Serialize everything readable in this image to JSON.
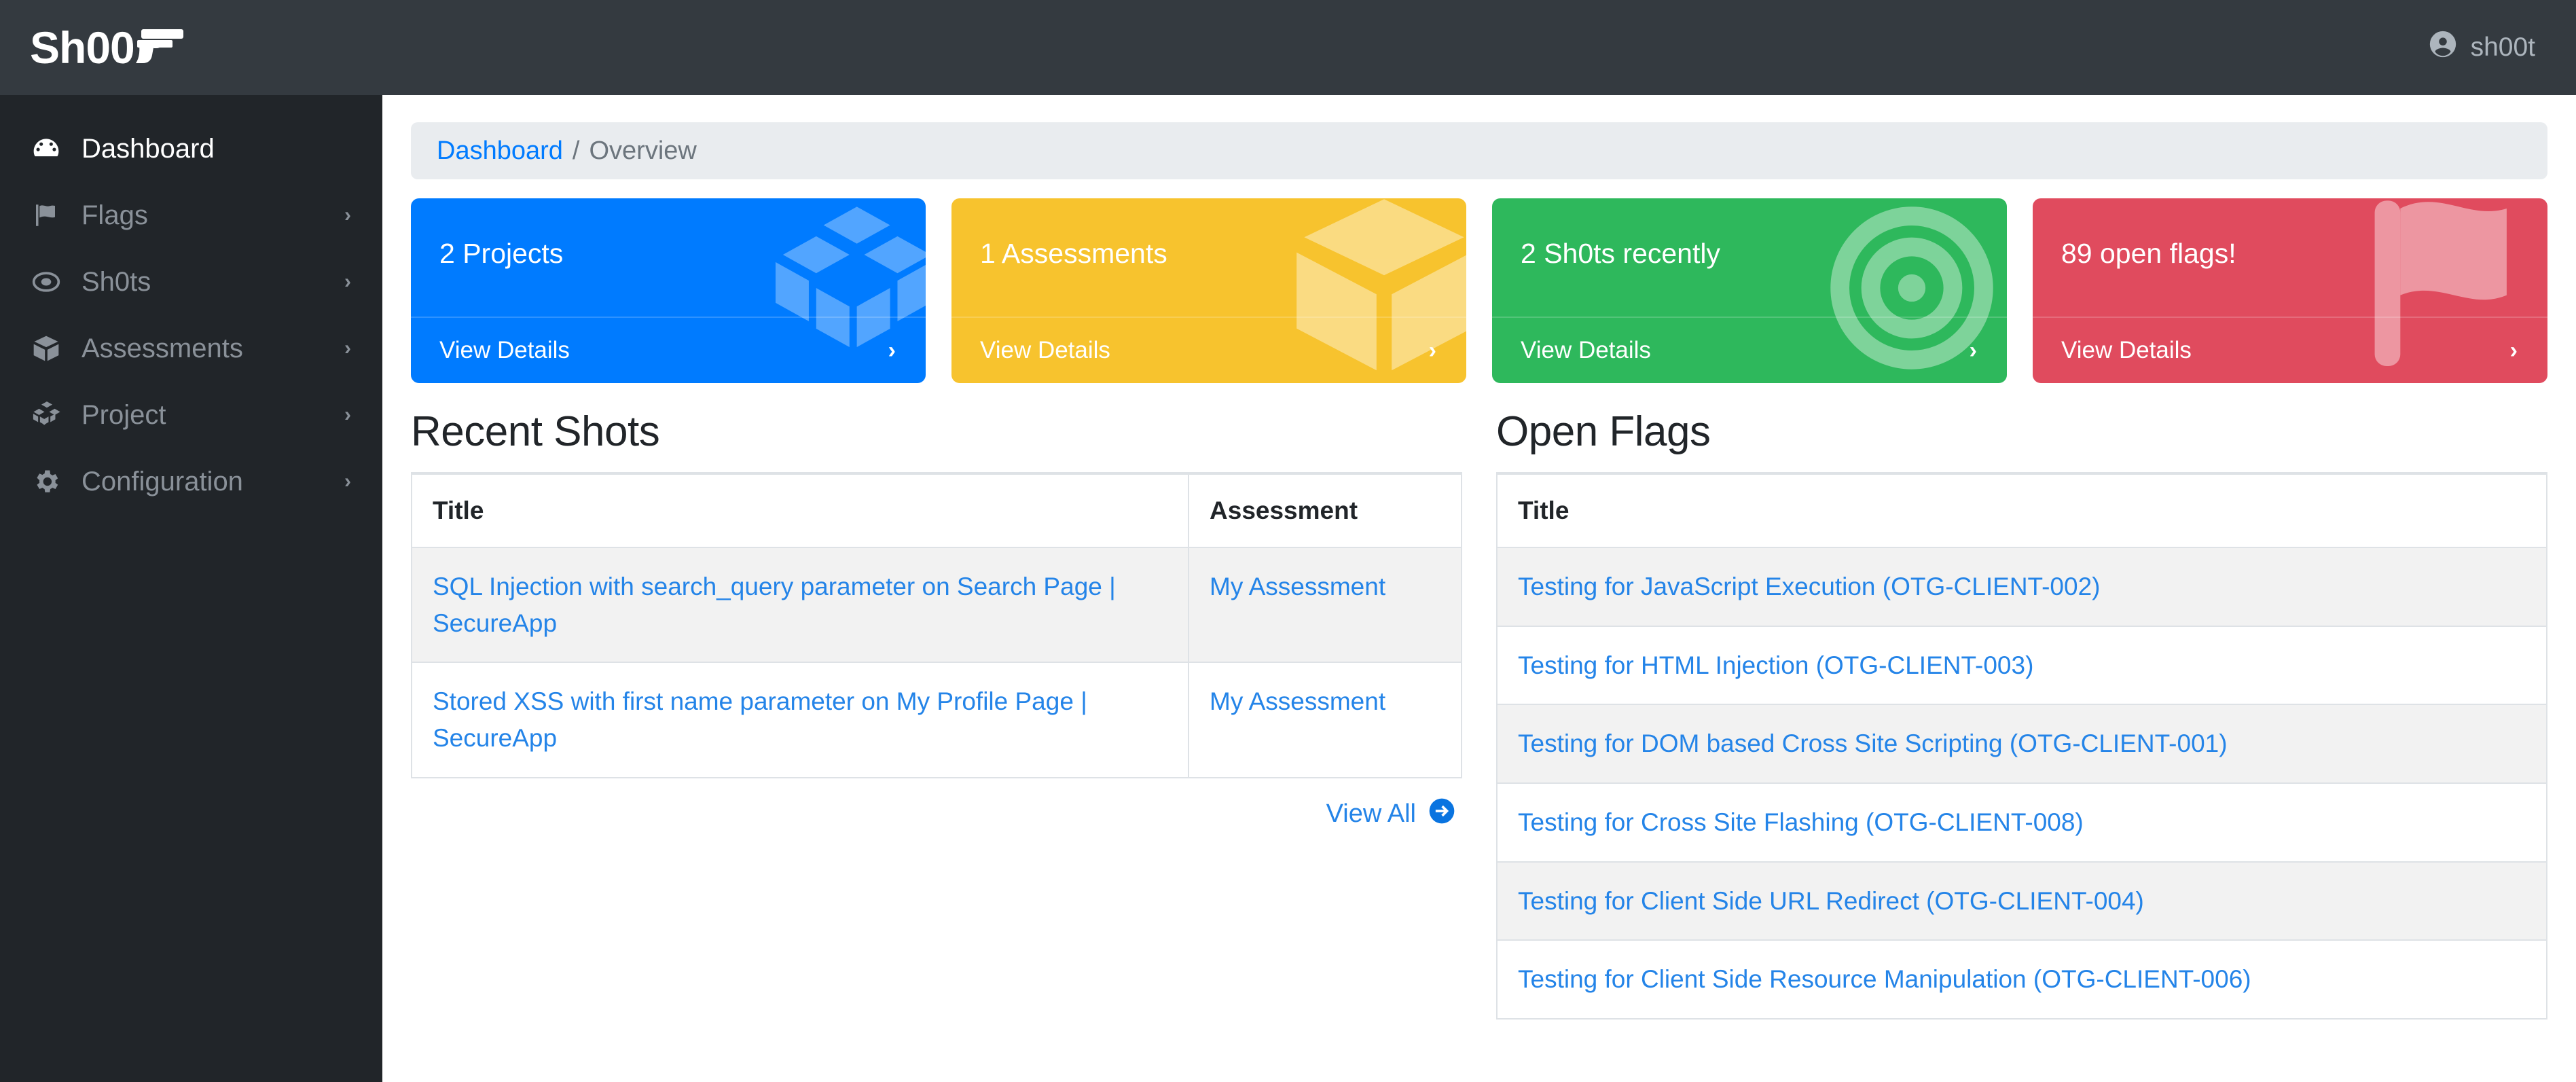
{
  "header": {
    "brand_text": "Sh00",
    "brand_icon": "pistol-icon",
    "user_name": "sh00t",
    "user_icon": "user-circle-icon",
    "background_color": "#343a40"
  },
  "sidebar": {
    "background_color": "#212529",
    "items": [
      {
        "label": "Dashboard",
        "icon": "tachometer-icon",
        "active": true,
        "chevron": ""
      },
      {
        "label": "Flags",
        "icon": "flag-icon",
        "active": false,
        "chevron": "›"
      },
      {
        "label": "Sh0ts",
        "icon": "bullseye-icon",
        "active": false,
        "chevron": "›"
      },
      {
        "label": "Assessments",
        "icon": "box-icon",
        "active": false,
        "chevron": "›"
      },
      {
        "label": "Project",
        "icon": "cubes-icon",
        "active": false,
        "chevron": "›"
      },
      {
        "label": "Configuration",
        "icon": "gear-icon",
        "active": false,
        "chevron": "›"
      }
    ]
  },
  "breadcrumb": {
    "link_label": "Dashboard",
    "separator": "/",
    "current_label": "Overview"
  },
  "cards": [
    {
      "value_label": "2 Projects",
      "footer_label": "View Details",
      "chevron": "›",
      "color": "#007bff",
      "icon": "cubes-icon"
    },
    {
      "value_label": "1 Assessments",
      "footer_label": "View Details",
      "chevron": "›",
      "color": "#f7c32e",
      "icon": "box-icon"
    },
    {
      "value_label": "2 Sh0ts recently",
      "footer_label": "View Details",
      "chevron": "›",
      "color": "#2eb85c",
      "icon": "bullseye-icon"
    },
    {
      "value_label": "89 open flags!",
      "footer_label": "View Details",
      "chevron": "›",
      "color": "#e04b5e",
      "icon": "flag-icon"
    }
  ],
  "recent_shots": {
    "title": "Recent Shots",
    "columns": [
      "Title",
      "Assessment"
    ],
    "rows": [
      {
        "title": "SQL Injection with search_query parameter on Search Page | SecureApp",
        "assessment": "My Assessment"
      },
      {
        "title": "Stored XSS with first name parameter on My Profile Page | SecureApp",
        "assessment": "My Assessment"
      }
    ],
    "view_all_label": "View All",
    "view_all_icon": "arrow-circle-right-icon"
  },
  "open_flags": {
    "title": "Open Flags",
    "columns": [
      "Title"
    ],
    "rows": [
      {
        "title": "Testing for JavaScript Execution (OTG-CLIENT-002)"
      },
      {
        "title": "Testing for HTML Injection (OTG-CLIENT-003)"
      },
      {
        "title": "Testing for DOM based Cross Site Scripting (OTG-CLIENT-001)"
      },
      {
        "title": "Testing for Cross Site Flashing (OTG-CLIENT-008)"
      },
      {
        "title": "Testing for Client Side URL Redirect (OTG-CLIENT-004)"
      },
      {
        "title": "Testing for Client Side Resource Manipulation (OTG-CLIENT-006)"
      }
    ]
  },
  "colors": {
    "link": "#2484e8",
    "breadcrumb_link": "#007bff",
    "muted": "#6c757d",
    "stripe": "#f2f2f2",
    "border": "#dee2e6"
  }
}
